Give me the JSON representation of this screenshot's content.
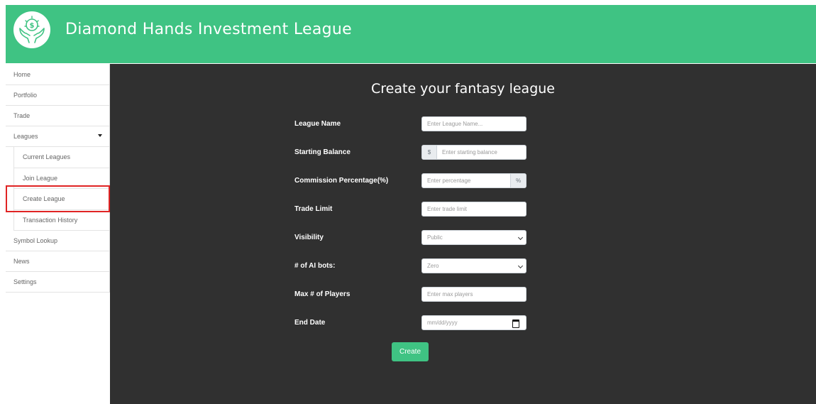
{
  "app": {
    "title": "Diamond Hands Investment League",
    "accent": "#3fc383",
    "main_bg": "#303030"
  },
  "sidebar": {
    "items": [
      {
        "label": "Home"
      },
      {
        "label": "Portfolio"
      },
      {
        "label": "Trade"
      },
      {
        "label": "Leagues",
        "expanded": true,
        "children": [
          {
            "label": "Current Leagues"
          },
          {
            "label": "Join League"
          },
          {
            "label": "Create League",
            "highlighted": true
          },
          {
            "label": "Transaction History"
          }
        ]
      },
      {
        "label": "Symbol Lookup"
      },
      {
        "label": "News"
      },
      {
        "label": "Settings"
      }
    ]
  },
  "form": {
    "title": "Create your fantasy league",
    "league_name": {
      "label": "League Name",
      "placeholder": "Enter League Name..."
    },
    "starting_balance": {
      "label": "Starting Balance",
      "prefix": "$",
      "placeholder": "Enter starting balance"
    },
    "commission": {
      "label": "Commission Percentage(%)",
      "placeholder": "Enter percentage",
      "suffix": "%"
    },
    "trade_limit": {
      "label": "Trade Limit",
      "placeholder": "Enter trade limit"
    },
    "visibility": {
      "label": "Visibility",
      "value": "Public"
    },
    "ai_bots": {
      "label": "# of AI bots:",
      "value": "Zero"
    },
    "max_players": {
      "label": "Max # of Players",
      "placeholder": "Enter max players"
    },
    "end_date": {
      "label": "End Date",
      "placeholder": "mm/dd/yyyy"
    },
    "submit_label": "Create"
  },
  "icons": {
    "logo": "money-hands-icon",
    "caret": "caret-down-icon",
    "select": "chevron-down-icon",
    "date": "calendar-icon"
  }
}
